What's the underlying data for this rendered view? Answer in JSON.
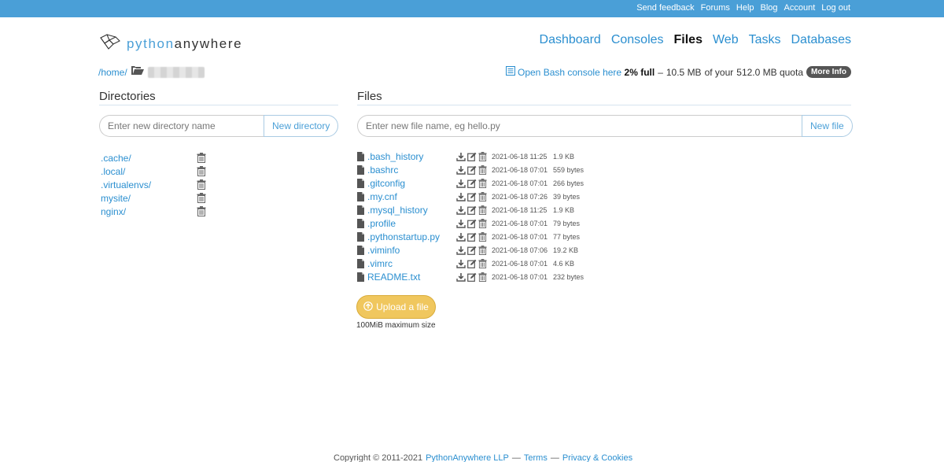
{
  "topbar": {
    "links": [
      "Send feedback",
      "Forums",
      "Help",
      "Blog",
      "Account",
      "Log out"
    ]
  },
  "logo": {
    "prefix": "python",
    "suffix": "anywhere"
  },
  "nav": {
    "items": [
      "Dashboard",
      "Consoles",
      "Files",
      "Web",
      "Tasks",
      "Databases"
    ],
    "active": "Files"
  },
  "breadcrumb": {
    "home": "/home/"
  },
  "bash_link": "Open Bash console here",
  "quota": {
    "percent": "2% full",
    "dash": "–",
    "used": "10.5 MB",
    "of_text": "of your",
    "total": "512.0 MB quota",
    "more_info": "More Info"
  },
  "directories": {
    "title": "Directories",
    "placeholder": "Enter new directory name",
    "button": "New directory",
    "items": [
      ".cache/",
      ".local/",
      ".virtualenvs/",
      "mysite/",
      "nginx/"
    ]
  },
  "files": {
    "title": "Files",
    "placeholder": "Enter new file name, eg hello.py",
    "button": "New file",
    "items": [
      {
        "name": ".bash_history",
        "date": "2021-06-18 11:25",
        "size": "1.9 KB"
      },
      {
        "name": ".bashrc",
        "date": "2021-06-18 07:01",
        "size": "559 bytes"
      },
      {
        "name": ".gitconfig",
        "date": "2021-06-18 07:01",
        "size": "266 bytes"
      },
      {
        "name": ".my.cnf",
        "date": "2021-06-18 07:26",
        "size": "39 bytes"
      },
      {
        "name": ".mysql_history",
        "date": "2021-06-18 11:25",
        "size": "1.9 KB"
      },
      {
        "name": ".profile",
        "date": "2021-06-18 07:01",
        "size": "79 bytes"
      },
      {
        "name": ".pythonstartup.py",
        "date": "2021-06-18 07:01",
        "size": "77 bytes"
      },
      {
        "name": ".viminfo",
        "date": "2021-06-18 07:06",
        "size": "19.2 KB"
      },
      {
        "name": ".vimrc",
        "date": "2021-06-18 07:01",
        "size": "4.6 KB"
      },
      {
        "name": "README.txt",
        "date": "2021-06-18 07:01",
        "size": "232 bytes"
      }
    ]
  },
  "upload": {
    "button": "Upload a file",
    "note": "100MiB maximum size"
  },
  "footer": {
    "copyright": "Copyright © 2011-2021",
    "company": "PythonAnywhere LLP",
    "sep1": "—",
    "terms": "Terms",
    "sep2": "—",
    "privacy": "Privacy & Cookies"
  },
  "colors": {
    "topbar": "#4a9fd7",
    "link": "#2b8fd0",
    "upload": "#f0c75e"
  }
}
